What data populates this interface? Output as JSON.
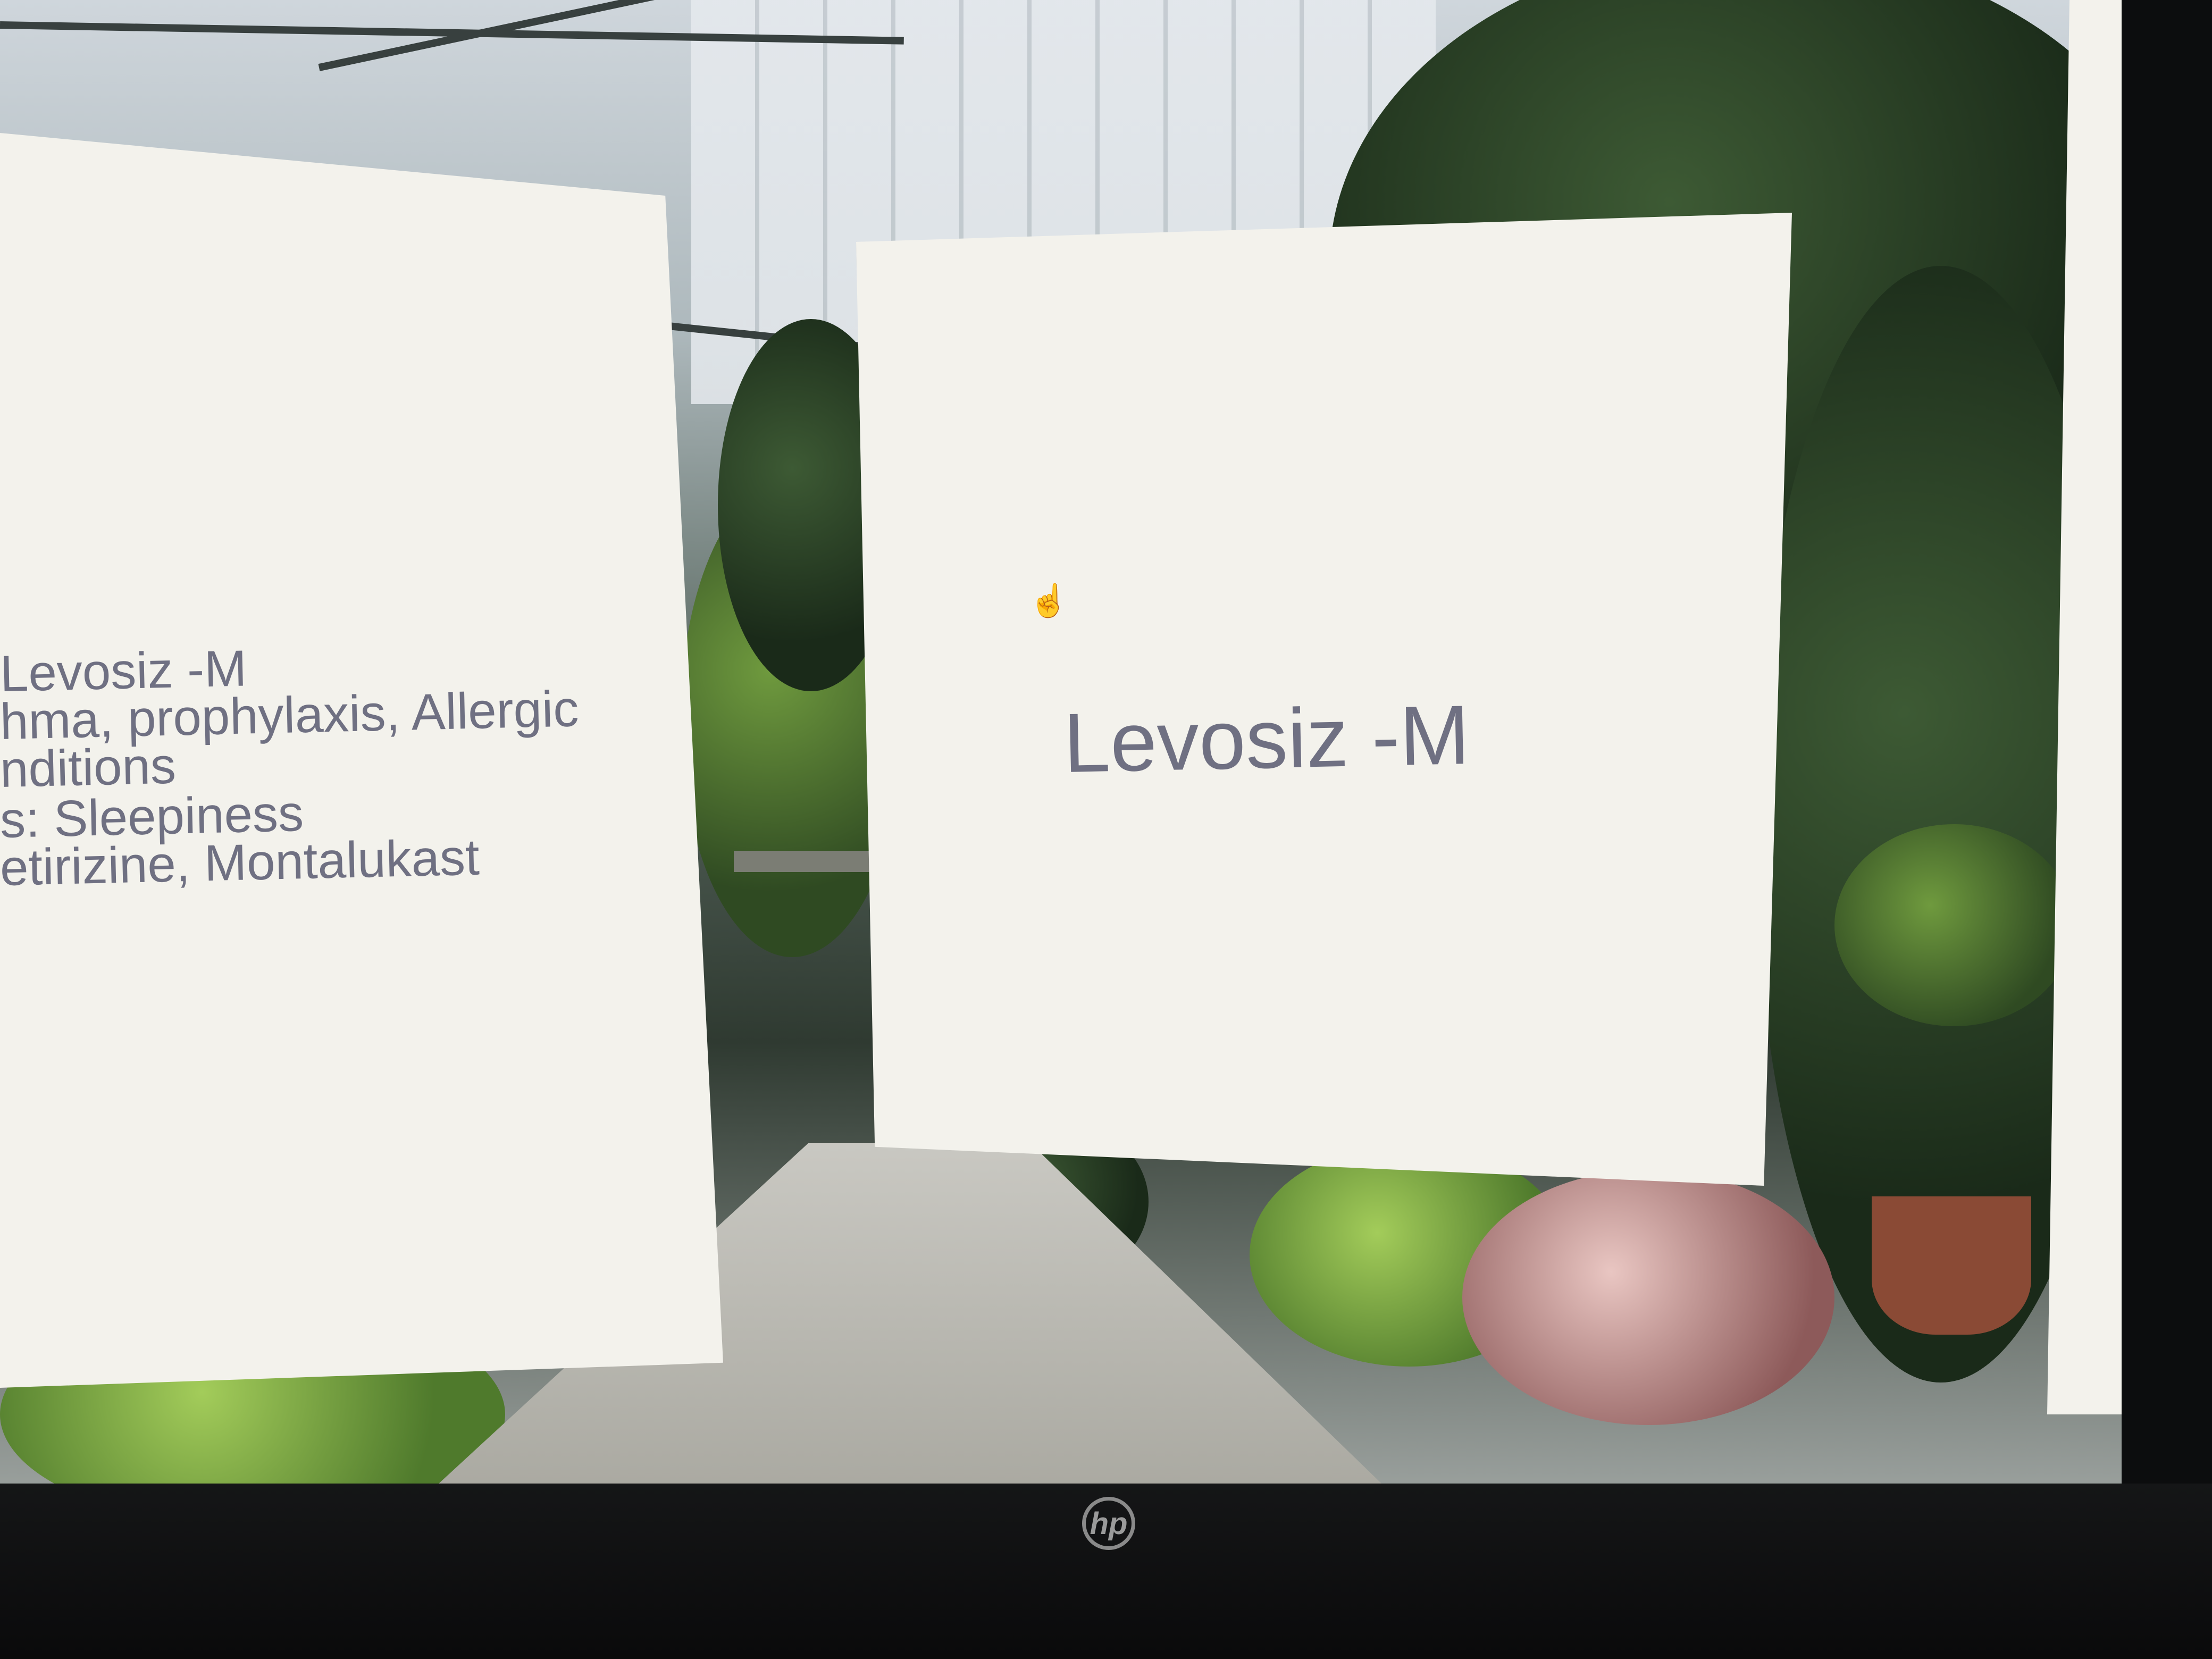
{
  "left_card": {
    "line1": "Levosiz -M",
    "line2": "hma, prophylaxis, Allergic",
    "line3": "nditions",
    "line4": "s: Sleepiness",
    "line5": "etirizine, Montalukast"
  },
  "center_card": {
    "title": "Levosiz -M"
  },
  "bezel": {
    "logo": "hp"
  },
  "icons": {
    "cursor": "hand-cursor-icon"
  }
}
